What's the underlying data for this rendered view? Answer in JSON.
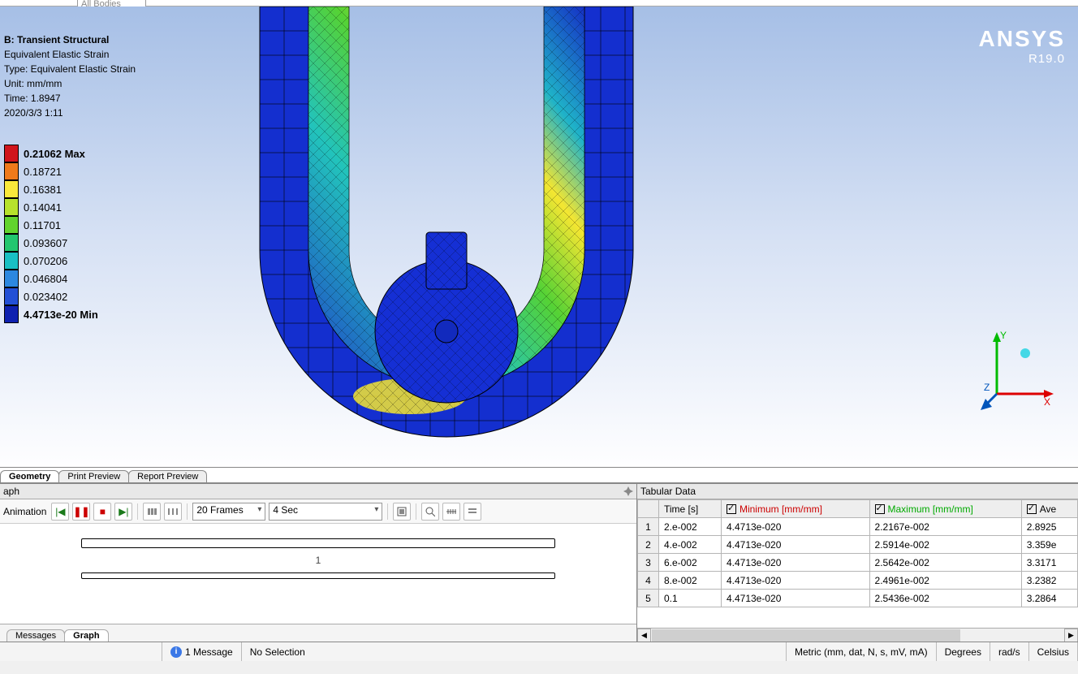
{
  "filter_text": "All Bodies",
  "viewport": {
    "title": "B: Transient Structural",
    "lines": [
      "Equivalent Elastic Strain",
      "Type: Equivalent Elastic Strain",
      "Unit: mm/mm",
      "Time: 1.8947",
      "2020/3/3 1:11"
    ],
    "brand": "ANSYS",
    "brand_sub": "R19.0",
    "legend": [
      {
        "c": "#d0151c",
        "t": "0.21062 Max",
        "b": true
      },
      {
        "c": "#ef7a1b",
        "t": "0.18721"
      },
      {
        "c": "#f9e93b",
        "t": "0.16381"
      },
      {
        "c": "#b7e22c",
        "t": "0.14041"
      },
      {
        "c": "#62d32e",
        "t": "0.11701"
      },
      {
        "c": "#22c66f",
        "t": "0.093607"
      },
      {
        "c": "#19c0c4",
        "t": "0.070206"
      },
      {
        "c": "#2c88e0",
        "t": "0.046804"
      },
      {
        "c": "#2350d6",
        "t": "0.023402"
      },
      {
        "c": "#0f21b0",
        "t": "4.4713e-20 Min",
        "b": true
      }
    ]
  },
  "geom_tabs": [
    "Geometry",
    "Print Preview",
    "Report Preview"
  ],
  "graph": {
    "pane_title": "aph",
    "anim_label": "Animation",
    "frames": "20 Frames",
    "duration": "4 Sec",
    "track_caption": "1",
    "lower_tabs": [
      "Messages",
      "Graph"
    ],
    "lower_active": "Graph"
  },
  "tabular": {
    "pane_title": "Tabular Data",
    "headers": {
      "time": "Time [s]",
      "min": "Minimum [mm/mm]",
      "max": "Maximum [mm/mm]",
      "ave": "Ave"
    },
    "rows": [
      {
        "n": "1",
        "t": "2.e-002",
        "min": "4.4713e-020",
        "max": "2.2167e-002",
        "ave": "2.8925"
      },
      {
        "n": "2",
        "t": "4.e-002",
        "min": "4.4713e-020",
        "max": "2.5914e-002",
        "ave": "3.359e"
      },
      {
        "n": "3",
        "t": "6.e-002",
        "min": "4.4713e-020",
        "max": "2.5642e-002",
        "ave": "3.3171"
      },
      {
        "n": "4",
        "t": "8.e-002",
        "min": "4.4713e-020",
        "max": "2.4961e-002",
        "ave": "3.2382"
      },
      {
        "n": "5",
        "t": "0.1",
        "min": "4.4713e-020",
        "max": "2.5436e-002",
        "ave": "3.2864"
      }
    ]
  },
  "status": {
    "msg": "1 Message",
    "sel": "No Selection",
    "units": "Metric (mm, dat, N, s, mV, mA)",
    "ang": "Degrees",
    "rot": "rad/s",
    "temp": "Celsius"
  }
}
